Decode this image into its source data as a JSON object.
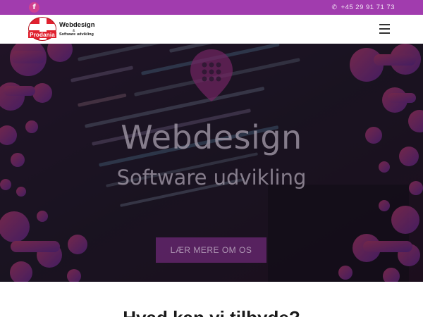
{
  "topbar": {
    "social_icon": "facebook-icon",
    "social_glyph": "f",
    "phone_icon": "phone-icon",
    "phone": "+45 29 91 71 73",
    "color": "#a13cae"
  },
  "header": {
    "logo_brand": "Prodania",
    "logo_title": "Webdesign",
    "logo_amp": "&",
    "logo_sub": "Software udvikling",
    "menu_icon": "hamburger-menu-icon",
    "logo_color": "#e0212f"
  },
  "hero": {
    "title": "Webdesign",
    "subtitle": "Software udvikling",
    "button_label": "LÆR MERE OM OS",
    "accent": "#c0399c",
    "pin_icon": "map-pin-grid-icon"
  },
  "section": {
    "heading": "Hvad kan vi tilbyde?"
  }
}
